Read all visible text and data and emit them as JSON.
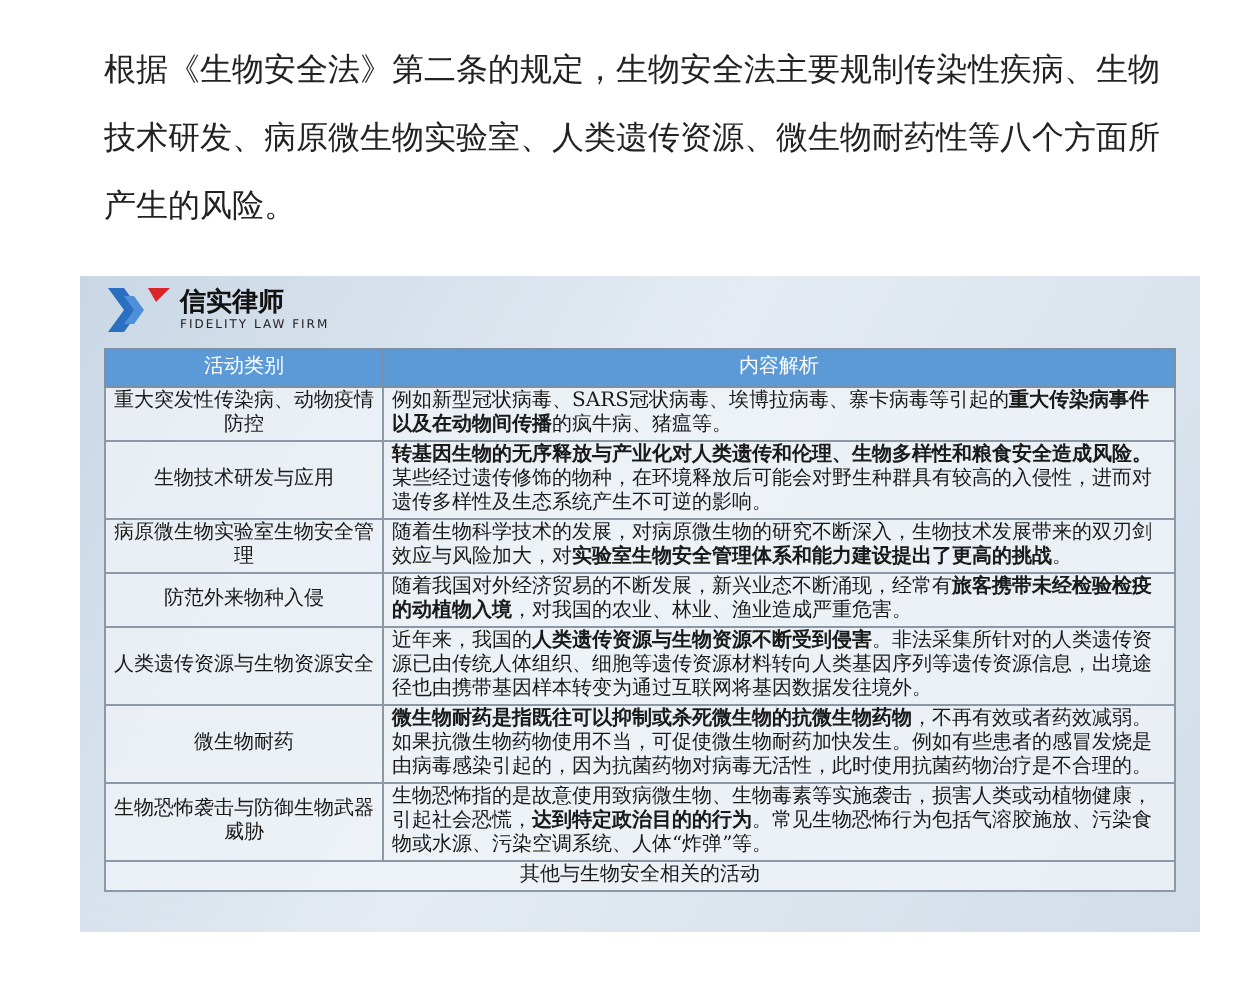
{
  "intro": "根据《生物安全法》第二条的规定，生物安全法主要规制传染性疾病、生物技术研发、病原微生物实验室、人类遗传资源、微生物耐药性等八个方面所产生的风险。",
  "logo": {
    "name": "信实律师",
    "subtitle": "FIDELITY LAW FIRM"
  },
  "table": {
    "columns": [
      "活动类别",
      "内容解析"
    ],
    "rows": [
      {
        "category": "重大突发性传染病、动物疫情防控",
        "analysis": "例如新型冠状病毒、SARS冠状病毒、埃博拉病毒、寨卡病毒等引起的**重大传染病事件以及在动物间传播**的疯牛病、猪瘟等。"
      },
      {
        "category": "生物技术研发与应用",
        "analysis": "**转基因生物的无序释放与产业化对人类遗传和伦理、生物多样性和粮食安全造成风险。**某些经过遗传修饰的物种，在环境释放后可能会对野生种群具有较高的入侵性，进而对遗传多样性及生态系统产生不可逆的影响。"
      },
      {
        "category": "病原微生物实验室生物安全管理",
        "analysis": "随着生物科学技术的发展，对病原微生物的研究不断深入，生物技术发展带来的双刃剑效应与风险加大，对**实验室生物安全管理体系和能力建设提出了更高的挑战**。"
      },
      {
        "category": "防范外来物种入侵",
        "analysis": "随着我国对外经济贸易的不断发展，新兴业态不断涌现，经常有**旅客携带未经检验检疫的动植物入境**，对我国的农业、林业、渔业造成严重危害。"
      },
      {
        "category": "人类遗传资源与生物资源安全",
        "analysis": "近年来，我国的**人类遗传资源与生物资源不断受到侵害**。非法采集所针对的人类遗传资源已由传统人体组织、细胞等遗传资源材料转向人类基因序列等遗传资源信息，出境途径也由携带基因样本转变为通过互联网将基因数据发往境外。"
      },
      {
        "category": "微生物耐药",
        "analysis": "**微生物耐药是指既往可以抑制或杀死微生物的抗微生物药物**，不再有效或者药效减弱。如果抗微生物药物使用不当，可促使微生物耐药加快发生。例如有些患者的感冒发烧是由病毒感染引起的，因为抗菌药物对病毒无活性，此时使用抗菌药物治疗是不合理的。"
      },
      {
        "category": "生物恐怖袭击与防御生物武器威胁",
        "analysis": "生物恐怖指的是故意使用致病微生物、生物毒素等实施袭击，损害人类或动植物健康，引起社会恐慌，**达到特定政治目的的行为**。常见生物恐怖行为包括气溶胶施放、污染食物或水源、污染空调系统、人体“炸弹”等。"
      }
    ],
    "footer": "其他与生物安全相关的活动"
  }
}
